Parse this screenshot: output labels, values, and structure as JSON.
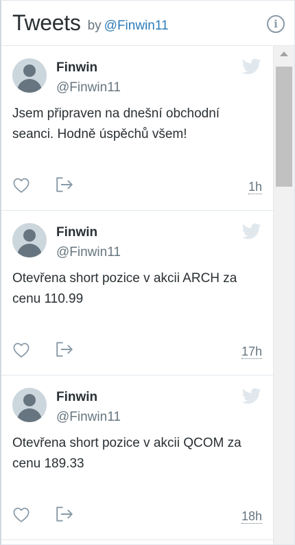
{
  "header": {
    "title": "Tweets",
    "by_label": "by",
    "handle": "@Finwin11",
    "info_icon": "info-icon",
    "info_glyph": "i"
  },
  "tweets": [
    {
      "name": "Finwin",
      "handle": "@Finwin11",
      "text": "Jsem připraven na dnešní obchodní seanci. Hodně úspěchů všem!",
      "time": "1h"
    },
    {
      "name": "Finwin",
      "handle": "@Finwin11",
      "text": "Otevřena short pozice v akcii ARCH za cenu 110.99",
      "time": "17h"
    },
    {
      "name": "Finwin",
      "handle": "@Finwin11",
      "text": "Otevřena short pozice v akcii QCOM za cenu 189.33",
      "time": "18h"
    }
  ],
  "colors": {
    "bird": "#e1e8ed",
    "icon_gray": "#8899a6",
    "handle_link": "#2b7bb9"
  }
}
